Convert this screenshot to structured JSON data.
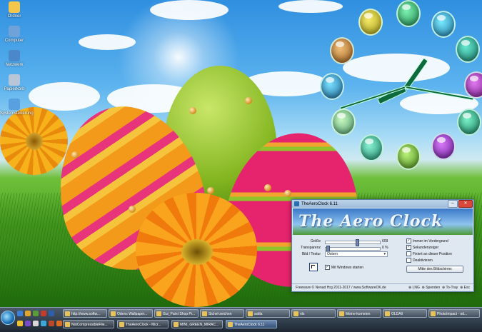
{
  "desktop": {
    "icons": [
      {
        "label": "Ordner",
        "color": "#f3c74b"
      },
      {
        "label": "Computer",
        "color": "#6fa2d8"
      },
      {
        "label": "Netzwerk",
        "color": "#4a88c9"
      },
      {
        "label": "Papierkorb",
        "color": "#b8c7d8"
      },
      {
        "label": "Systemsteuerung",
        "color": "#58a0e0"
      }
    ]
  },
  "window": {
    "title": "TheAeroClock 6.11",
    "banner": "The Aero Clock",
    "labels": {
      "size": "Größe",
      "transparency": "Transparenz",
      "texture": "Bild / Textur"
    },
    "values": {
      "size": "609",
      "transparency": "0 %",
      "texture": "Ostern"
    },
    "size_level": 0.58,
    "transparency_level": 0.02,
    "checkboxes": [
      {
        "label": "Immer im Vordergrund",
        "checked": true
      },
      {
        "label": "Sekundenzeiger",
        "checked": true
      },
      {
        "label": "Fixiert an dieser Position",
        "checked": false
      },
      {
        "label": "Deaktivieren",
        "checked": false
      }
    ],
    "autostart": {
      "label": "Mit Windows starten",
      "checked": true
    },
    "center_button": "Mitte des Bildschirms",
    "footer": {
      "left": "Freeware © Nenad Hrg 2011-2017 / www.SoftwareOK.de",
      "lng": "LNG",
      "donate": "Spenden",
      "tray": "To-Tray",
      "esc": "Esc"
    }
  },
  "taskbar": {
    "row1": [
      "http://www.softw...",
      "Odens Wallpaper...",
      "Gui_Paint Shop Pr...",
      "Sichel-zeichen",
      "sstila",
      "nls",
      "Meine-kommen",
      "OLDAll",
      "PhotoImpact - od..."
    ],
    "row2": [
      "NotCompressibleFile...",
      "TheAeroClock - Micr...",
      "MINI_GREEN_MIRAC...",
      "TheAeroClock 6.11"
    ]
  }
}
